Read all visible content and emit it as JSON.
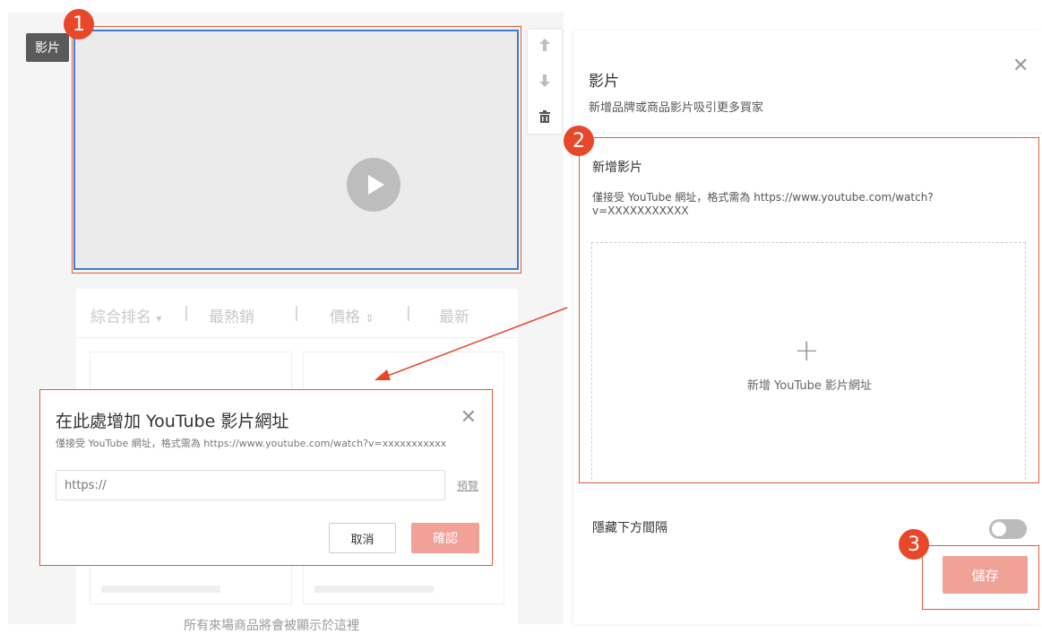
{
  "canvas": {
    "video_tag": "影片",
    "sort_bar": {
      "items": [
        "綜合排名",
        "最熱銷",
        "價格",
        "最新"
      ],
      "separator": "|",
      "sort_down_icon": "▾",
      "sort_both_icon": "⇕"
    },
    "footnote": "所有來場商品將會被顯示於這裡"
  },
  "tools": {
    "up_icon": "arrow-up-icon",
    "down_icon": "arrow-down-icon",
    "delete_icon": "trash-icon"
  },
  "modal": {
    "title": "在此處增加 YouTube 影片網址",
    "hint": "僅接受 YouTube 網址，格式需為 https://www.youtube.com/watch?v=xxxxxxxxxxx",
    "input_placeholder": "https://",
    "preview": "預覽",
    "cancel": "取消",
    "confirm": "確認",
    "close": "✕"
  },
  "panel": {
    "title": "影片",
    "subtitle": "新增品牌或商品影片吸引更多買家",
    "close": "✕",
    "section_title": "新增影片",
    "section_hint": "僅接受 YouTube 網址，格式需為 https://www.youtube.com/watch?v=XXXXXXXXXXX",
    "add_plus": "+",
    "add_label": "新增 YouTube 影片網址",
    "hide_spacing": "隱藏下方間隔",
    "save": "儲存"
  },
  "badges": [
    "1",
    "2",
    "3"
  ],
  "colors": {
    "accent": "#e8472a",
    "save_button": "#f0a198",
    "selection_blue": "#3a7bd5"
  }
}
